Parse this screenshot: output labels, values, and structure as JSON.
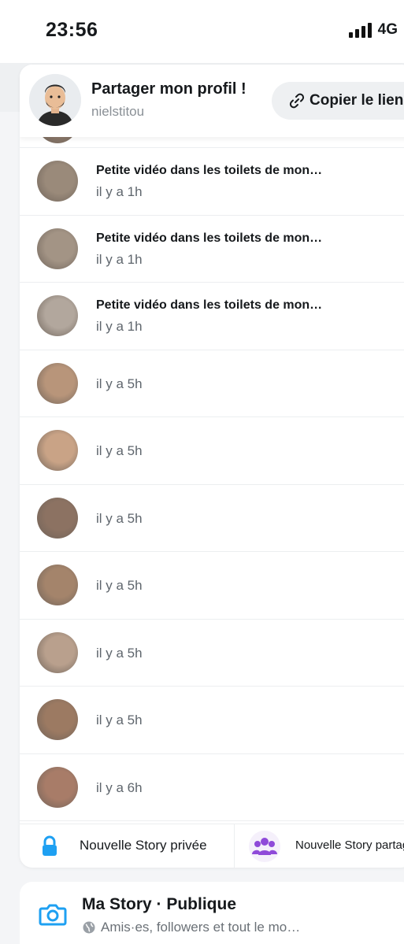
{
  "status_bar": {
    "time": "23:56",
    "network": "4G"
  },
  "profile": {
    "title": "Partager mon profil !",
    "username": "nielstitou",
    "copy_link_label": "Copier le lien"
  },
  "stories": [
    {
      "title": "",
      "time": "",
      "thumb": "#8f7b6c",
      "partial": true
    },
    {
      "title": "Petite vidéo dans les toilets de mon…",
      "time": "il y a 1h",
      "thumb": "#9a8a7a"
    },
    {
      "title": "Petite vidéo dans les toilets de mon…",
      "time": "il y a 1h",
      "thumb": "#a39485"
    },
    {
      "title": "Petite vidéo dans les toilets de mon…",
      "time": "il y a 1h",
      "thumb": "#b2a79d"
    },
    {
      "title": "",
      "time": "il y a 5h",
      "thumb": "#b8957a"
    },
    {
      "title": "",
      "time": "il y a 5h",
      "thumb": "#c9a386"
    },
    {
      "title": "",
      "time": "il y a 5h",
      "thumb": "#8c7262"
    },
    {
      "title": "",
      "time": "il y a 5h",
      "thumb": "#a4846b"
    },
    {
      "title": "",
      "time": "il y a 5h",
      "thumb": "#b9a08d"
    },
    {
      "title": "",
      "time": "il y a 5h",
      "thumb": "#9c7a62"
    },
    {
      "title": "",
      "time": "il y a 6h",
      "thumb": "#a87c68"
    }
  ],
  "new_story": {
    "private_label": "Nouvelle Story privée",
    "shared_label": "Nouvelle Story partagée",
    "private_icon": "lock-icon",
    "shared_icon": "group-icon",
    "private_color": "#1ea0f2",
    "shared_color": "#8f4ad9"
  },
  "my_story": {
    "title": "Ma Story · Publique",
    "subtitle": "Amis·es, followers et tout le mo…",
    "icon": "camera-icon",
    "icon_color": "#1ea0f2"
  }
}
